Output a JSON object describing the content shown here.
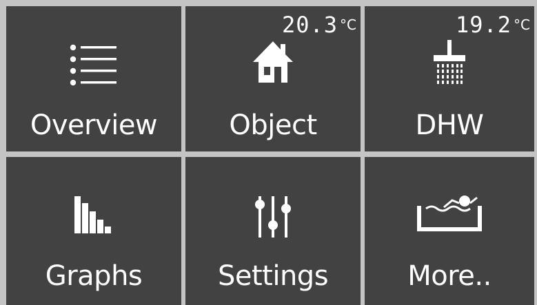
{
  "tiles": [
    {
      "label": "Overview",
      "icon": "list-icon"
    },
    {
      "label": "Object",
      "icon": "house-icon",
      "temperature": "20.3",
      "unit": "°C"
    },
    {
      "label": "DHW",
      "icon": "shower-icon",
      "temperature": "19.2",
      "unit": "°C"
    },
    {
      "label": "Graphs",
      "icon": "bar-chart-icon"
    },
    {
      "label": "Settings",
      "icon": "sliders-icon"
    },
    {
      "label": "More..",
      "icon": "pool-icon"
    }
  ],
  "colors": {
    "tile_bg": "#424242",
    "grid_bg": "#c4c4c4",
    "foreground": "#ffffff"
  }
}
